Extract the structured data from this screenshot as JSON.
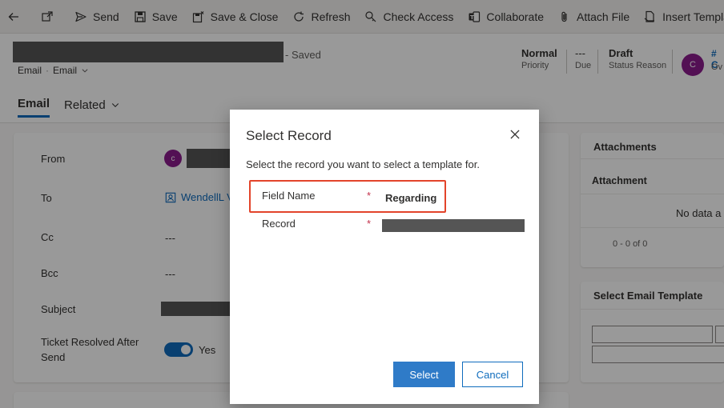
{
  "command_bar": {
    "items": [
      {
        "label": "",
        "icon": "back-arrow-icon"
      },
      {
        "label": "",
        "icon": "popout-icon"
      },
      {
        "label": "Send",
        "icon": "send-icon"
      },
      {
        "label": "Save",
        "icon": "save-icon"
      },
      {
        "label": "Save & Close",
        "icon": "save-close-icon"
      },
      {
        "label": "Refresh",
        "icon": "refresh-icon"
      },
      {
        "label": "Check Access",
        "icon": "check-access-icon"
      },
      {
        "label": "Collaborate",
        "icon": "collaborate-icon"
      },
      {
        "label": "Attach File",
        "icon": "attach-icon"
      },
      {
        "label": "Insert Template",
        "icon": "insert-template-icon"
      }
    ]
  },
  "header": {
    "saved_status": "- Saved",
    "form_entity": "Email",
    "form_name": "Email",
    "priority_value": "Normal",
    "priority_label": "Priority",
    "due_value": "---",
    "due_label": "Due",
    "status_value": "Draft",
    "status_label": "Status Reason",
    "owner_avatar_initial": "C",
    "owner_partial": "# C",
    "owner_label_partial": "Ov"
  },
  "tabs": [
    {
      "label": "Email",
      "active": true
    },
    {
      "label": "Related",
      "active": false
    }
  ],
  "form": {
    "from_label": "From",
    "from_avatar_initial": "c",
    "to_label": "To",
    "to_value": "WendellL V",
    "cc_label": "Cc",
    "cc_value": "---",
    "bcc_label": "Bcc",
    "bcc_value": "---",
    "subject_label": "Subject",
    "ticket_label_line1": "Ticket Resolved After",
    "ticket_label_line2": "Send",
    "ticket_value": "Yes",
    "ticket_toggle_on": true
  },
  "right_panes": {
    "attachments_title": "Attachments",
    "attachment_col": "Attachment",
    "no_data": "No data a",
    "pager": "0 - 0 of 0",
    "template_title": "Select Email Template"
  },
  "dialog": {
    "title": "Select Record",
    "subtitle": "Select the record you want to select a template for.",
    "field_name_label": "Field Name",
    "field_name_value": "Regarding",
    "record_label": "Record",
    "required_marker": "*",
    "select_button": "Select",
    "cancel_button": "Cancel",
    "highlight_color": "#e3442a"
  },
  "colors": {
    "accent": "#0f6cbd",
    "primary_button": "#2f7bc8",
    "avatar": "#8b1c8c",
    "required": "#c4314b"
  }
}
